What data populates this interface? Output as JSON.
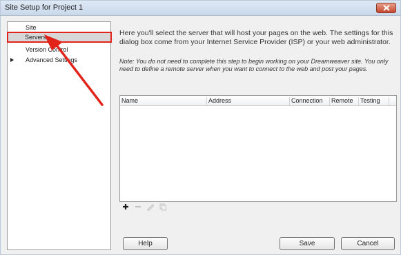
{
  "window": {
    "title": "Site Setup for Project 1"
  },
  "sidebar": {
    "items": [
      {
        "label": "Site"
      },
      {
        "label": "Servers"
      },
      {
        "label": "Version Control"
      },
      {
        "label": "Advanced Settings"
      }
    ]
  },
  "main": {
    "intro": "Here you'll select the server that will host your pages on the web. The settings for this dialog box come from your Internet Service Provider (ISP) or your web administrator.",
    "note": "Note: You do not need to complete this step to begin working on your Dreamweaver site. You only need to define a remote server when you want to connect to the web and post your pages."
  },
  "table": {
    "columns": [
      "Name",
      "Address",
      "Connection",
      "Remote",
      "Testing"
    ],
    "rows": []
  },
  "toolbar": {
    "icons": [
      "add-icon",
      "remove-icon",
      "edit-icon",
      "duplicate-icon"
    ]
  },
  "buttons": {
    "help": "Help",
    "save": "Save",
    "cancel": "Cancel"
  },
  "colors": {
    "highlight": "#e2231a",
    "arrow": "#e2231a"
  }
}
